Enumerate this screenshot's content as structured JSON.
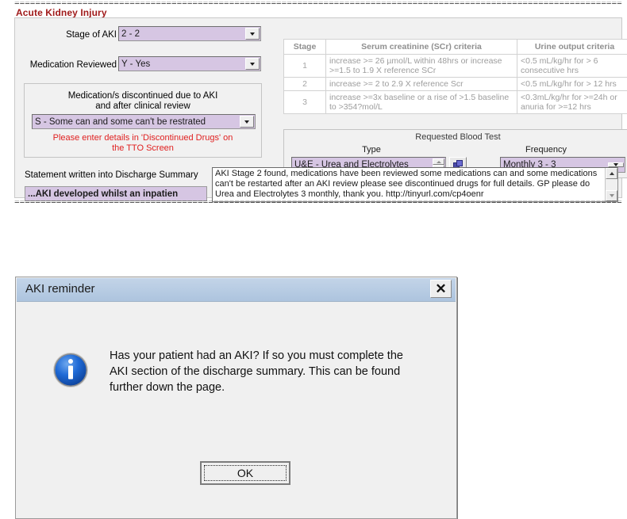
{
  "separators": {
    "top": "================================================================================================================================",
    "bottom": "================================================================================================================================"
  },
  "section": {
    "title": "Acute Kidney Injury"
  },
  "form": {
    "stage_label": "Stage of AKI",
    "stage_value": "2 - 2",
    "medication_reviewed_label": "Medication  Reviewed",
    "medication_reviewed_value": "Y - Yes",
    "discontinued_caption_line1": "Medication/s discontinued due to AKI",
    "discontinued_caption_line2": "and after clinical review",
    "discontinued_value": "S - Some can and some can't be restrated",
    "warning_line1": "Please enter details in 'Discontinued Drugs' on",
    "warning_line2": "the TTO Screen"
  },
  "criteria_table": {
    "headers": [
      "Stage",
      "Serum creatinine (SCr) criteria",
      "Urine output criteria"
    ],
    "rows": [
      {
        "stage": "1",
        "scr": "increase >= 26 µmol/L within 48hrs or increase >=1.5 to 1.9 X reference SCr",
        "urine": "<0.5 mL/kg/hr for > 6 consecutive hrs"
      },
      {
        "stage": "2",
        "scr": "increase >= 2 to 2.9 X reference Scr",
        "urine": "<0.5 mL/kg/hr for > 12 hrs"
      },
      {
        "stage": "3",
        "scr": "increase >=3x baseline or a rise of >1.5 baseline to >354?mol/L",
        "urine": "<0.3mL/kg/hr for >=24h or anuria for >=12 hrs"
      }
    ]
  },
  "blood_test": {
    "title": "Requested Blood Test",
    "type_label": "Type",
    "type_value": "U&E - Urea and Electrolytes",
    "frequency_label": "Frequency",
    "frequency_value": "Monthly 3 - 3"
  },
  "statement": {
    "label": "Statement written into Discharge Summary",
    "button_text": "...AKI developed whilst an inpatien",
    "summary_text": "AKI Stage 2 found, medications have been reviewed some medications can and some medications can't be restarted after an AKI review please see discontinued drugs for full details. GP please do Urea and Electrolytes 3 monthly, thank you. http://tinyurl.com/cp4oenr"
  },
  "dialog": {
    "title": "AKI reminder",
    "close_glyph": "✕",
    "message": "Has your patient had an AKI? If so you must complete the AKI section of the discharge summary. This can be found further down the page.",
    "ok_label": "OK"
  },
  "colors": {
    "section_title": "#a01b1b",
    "combo_fill": "#d6c6e3",
    "warning_text": "#e02020",
    "dialog_title_bar": "#b9cde4",
    "info_icon": "#1565d8"
  }
}
